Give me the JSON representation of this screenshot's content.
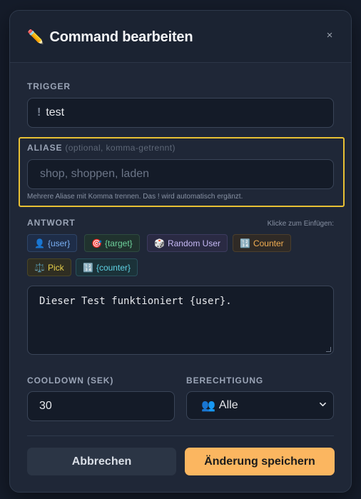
{
  "modal": {
    "title": "Command bearbeiten",
    "title_icon": "✏️",
    "close_glyph": "×"
  },
  "trigger": {
    "label": "TRIGGER",
    "prefix": "!",
    "value": "test"
  },
  "aliases": {
    "label": "ALIASE",
    "label_hint": "(optional, komma-getrennt)",
    "placeholder": "shop, shoppen, laden",
    "value": "",
    "helper": "Mehrere Aliase mit Komma trennen. Das ! wird automatisch ergänzt."
  },
  "response": {
    "label": "ANTWORT",
    "click_hint": "Klicke zum Einfügen:",
    "chips": [
      {
        "icon": "👤",
        "label": "{user}"
      },
      {
        "icon": "🎯",
        "label": "{target}"
      },
      {
        "icon": "🎲",
        "label": "Random User"
      },
      {
        "icon": "🔢",
        "label": "Counter"
      },
      {
        "icon": "⚖️",
        "label": "Pick"
      },
      {
        "icon": "🔢",
        "label": "{counter}"
      }
    ],
    "value": "Dieser Test funktioniert {user}."
  },
  "cooldown": {
    "label": "COOLDOWN (SEK)",
    "value": "30"
  },
  "permission": {
    "label": "BERECHTIGUNG",
    "icon": "👥",
    "selected": "Alle"
  },
  "actions": {
    "cancel_label": "Abbrechen",
    "save_label": "Änderung speichern"
  },
  "colors": {
    "accent": "#fbb660",
    "highlight_border": "#e8c034",
    "modal_bg": "#1f2737",
    "input_bg": "#141b28"
  }
}
